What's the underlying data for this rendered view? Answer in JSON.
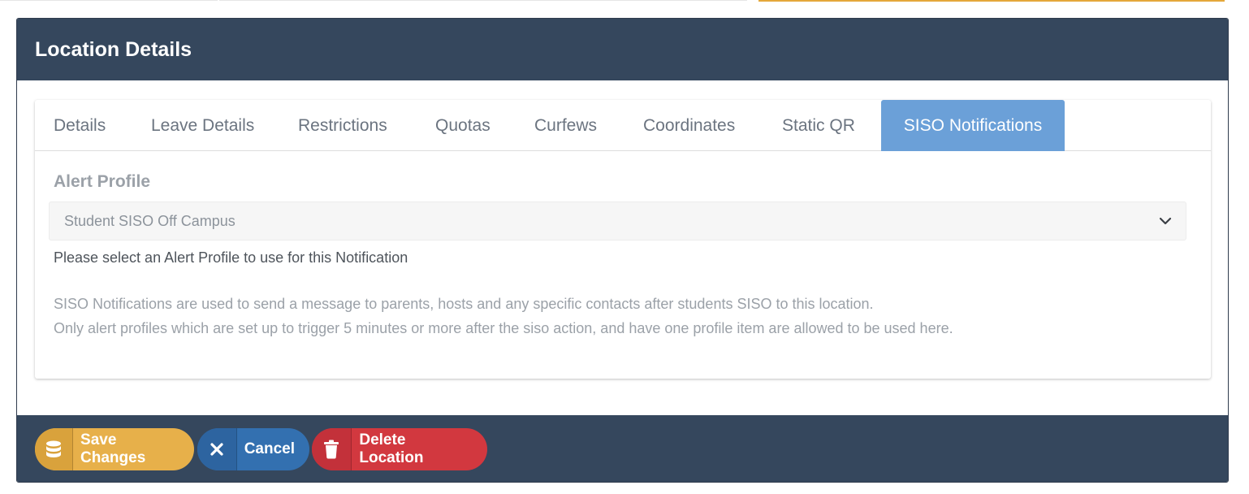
{
  "panel": {
    "title": "Location Details"
  },
  "tabs": [
    {
      "label": "Details"
    },
    {
      "label": "Leave Details"
    },
    {
      "label": "Restrictions"
    },
    {
      "label": "Quotas"
    },
    {
      "label": "Curfews"
    },
    {
      "label": "Coordinates"
    },
    {
      "label": "Static QR"
    },
    {
      "label": "SISO Notifications",
      "active": true
    }
  ],
  "form": {
    "alert_profile_label": "Alert Profile",
    "alert_profile_value": "Student SISO Off Campus",
    "help_text": "Please select an Alert Profile to use for this Notification",
    "info_lines": [
      "SISO Notifications are used to send a message to parents, hosts and any specific contacts after students SISO to this location.",
      "Only alert profiles which are set up to trigger 5 minutes or more after the siso action, and have one profile item are allowed to be used here."
    ]
  },
  "footer": {
    "save_label": "Save Changes",
    "cancel_label": "Cancel",
    "delete_label": "Delete Location"
  },
  "colors": {
    "header_bg": "#35475d",
    "active_tab": "#6ba0d8",
    "save": "#e7b04a",
    "cancel": "#3370b0",
    "delete": "#d2383f"
  },
  "icons": {
    "save": "database-icon",
    "cancel": "close-icon",
    "delete": "trash-icon",
    "select": "chevron-down-icon"
  }
}
